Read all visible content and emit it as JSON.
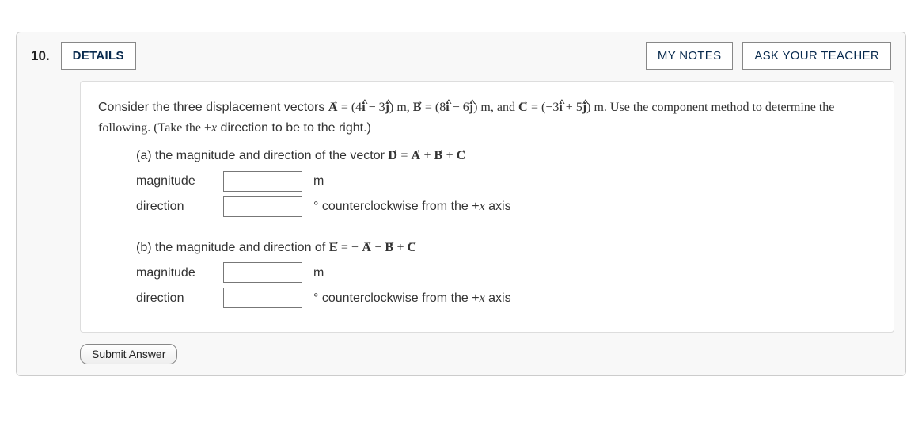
{
  "question": {
    "number": "10.",
    "details_label": "DETAILS",
    "my_notes_label": "MY NOTES",
    "ask_teacher_label": "ASK YOUR TEACHER",
    "prompt_pre": "Consider the three displacement vectors ",
    "vec_A": "A",
    "eq_A_open": " = (4",
    "ihat": "î",
    "eq_A_mid": " − 3",
    "jhat": "ĵ",
    "eq_A_close": ") m, ",
    "vec_B": "B",
    "eq_B_open": " = (8",
    "eq_B_mid": " − 6",
    "eq_B_close": ") m, and ",
    "vec_C": "C",
    "eq_C_open": " = (−3",
    "eq_C_mid": " + 5",
    "eq_C_close": ") m. Use the component method to determine the following. (Take the +",
    "x_var": "x",
    "prompt_tail": " direction to be to the right.)",
    "parts": {
      "a": {
        "lead": "(a) the magnitude and direction of the vector ",
        "vec_D": "D",
        "eq": " = ",
        "plus1": " + ",
        "plus2": " + ",
        "magnitude_label": "magnitude",
        "direction_label": "direction",
        "mag_unit": "m",
        "dir_unit": "° counterclockwise from the +",
        "dir_unit_tail": " axis"
      },
      "b": {
        "lead": "(b) the magnitude and direction of ",
        "vec_E": "E",
        "eq": " = −",
        "minus": " − ",
        "plus": " + ",
        "magnitude_label": "magnitude",
        "direction_label": "direction",
        "mag_unit": "m",
        "dir_unit": "° counterclockwise from the +",
        "dir_unit_tail": " axis"
      }
    },
    "submit_label": "Submit Answer"
  }
}
